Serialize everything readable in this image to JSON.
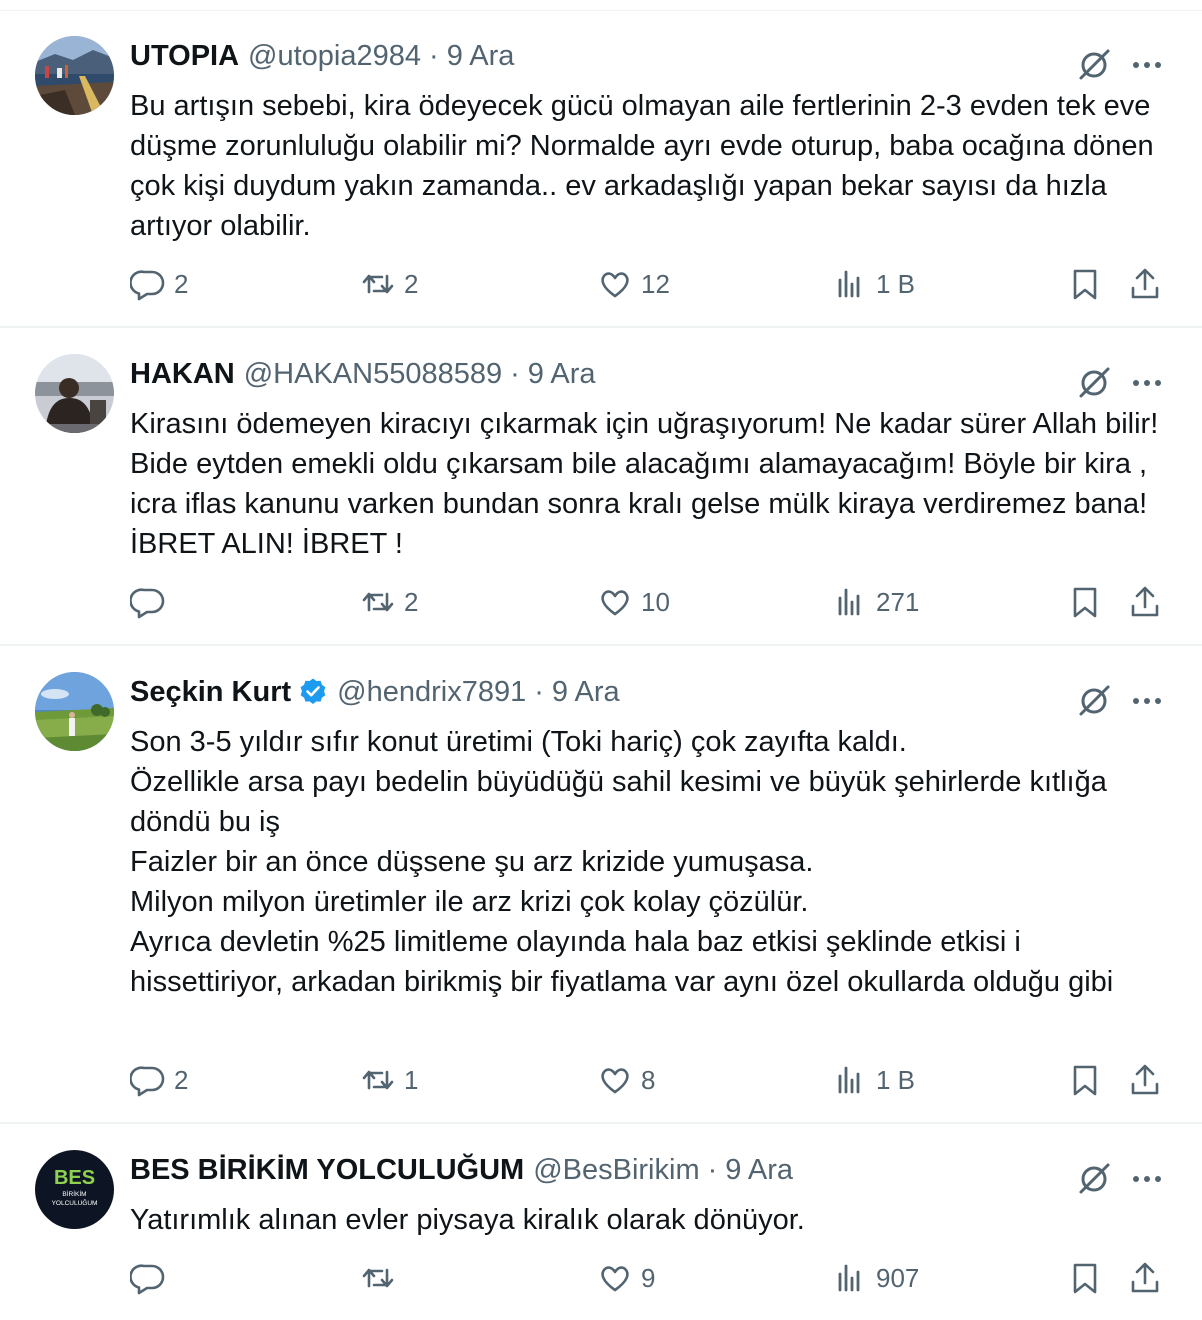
{
  "colors": {
    "text_primary": "#0f1419",
    "text_secondary": "#536471",
    "border": "#eff3f4",
    "verified_blue": "#1d9bf0"
  },
  "tweets": [
    {
      "display_name": "UTOPIA",
      "handle": "@utopia2984",
      "dot": "·",
      "time": "9 Ara",
      "verified": false,
      "text": "Bu artışın sebebi, kira ödeyecek gücü olmayan aile fertlerinin  2-3 evden tek eve düşme zorunluluğu olabilir mi? Normalde ayrı evde oturup, baba ocağına dönen çok kişi duydum yakın zamanda.. ev arkadaşlığı yapan bekar sayısı da hızla artıyor olabilir.",
      "replies": "2",
      "retweets": "2",
      "likes": "12",
      "views": "1 B",
      "avatar_icon": "landscape-avatar"
    },
    {
      "display_name": "HAKAN",
      "handle": "@HAKAN55088589",
      "dot": "·",
      "time": "9 Ara",
      "verified": false,
      "text": "Kirasını ödemeyen kiracıyı çıkarmak için uğraşıyorum! Ne kadar sürer Allah bilir! Bide eytden emekli oldu çıkarsam bile alacağımı alamayacağım! Böyle bir kira , icra iflas kanunu varken bundan sonra kralı gelse mülk kiraya verdiremez bana! İBRET ALIN! İBRET !",
      "replies": "",
      "retweets": "2",
      "likes": "10",
      "views": "271",
      "avatar_icon": "person-avatar"
    },
    {
      "display_name": "Seçkin Kurt",
      "handle": "@hendrix7891",
      "dot": "·",
      "time": "9 Ara",
      "verified": true,
      "text": "Son 3-5 yıldır sıfır konut üretimi (Toki hariç) çok zayıfta kaldı.\nÖzellikle arsa payı bedelin büyüdüğü sahil kesimi ve büyük şehirlerde kıtlığa döndü bu iş\nFaizler bir an önce düşsene şu arz krizide yumuşasa.\nMilyon milyon üretimler ile arz krizi çok kolay çözülür.\nAyrıca devletin %25 limitleme olayında hala baz etkisi şeklinde etkisi i hissettiriyor, arkadan birikmiş bir fiyatlama var aynı özel okullarda olduğu gibi",
      "replies": "2",
      "retweets": "1",
      "likes": "8",
      "views": "1 B",
      "avatar_icon": "golf-course-avatar"
    },
    {
      "display_name": "BES BİRİKİM YOLCULUĞUM",
      "handle": "@BesBirikim",
      "dot": "·",
      "time": "9 Ara",
      "verified": false,
      "text": "Yatırımlık alınan evler piysaya kiralık olarak dönüyor.",
      "replies": "",
      "retweets": "",
      "likes": "9",
      "views": "907",
      "avatar_icon": "bes-logo-avatar",
      "avatar_logo_text": "BES",
      "avatar_logo_sub1": "BİRİKİM",
      "avatar_logo_sub2": "YOLCULUĞUM"
    }
  ]
}
